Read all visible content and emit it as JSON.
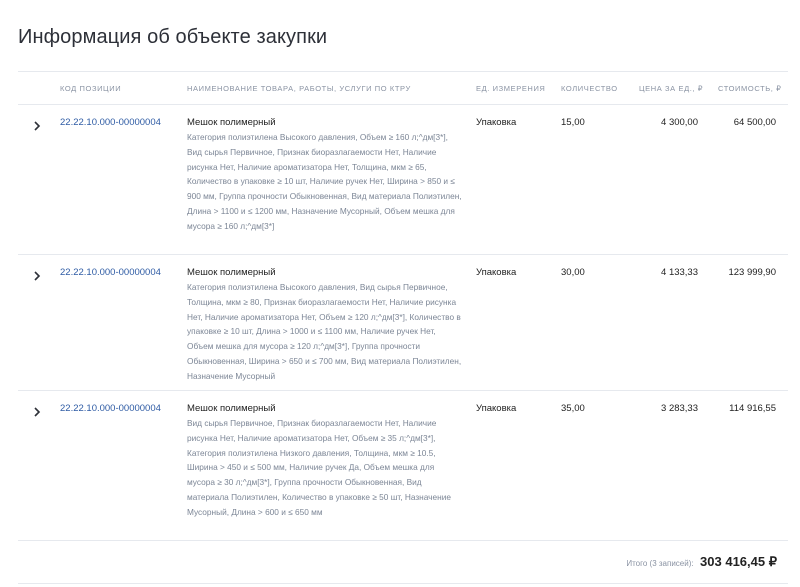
{
  "title": "Информация об объекте закупки",
  "columns": {
    "code": "КОД ПОЗИЦИИ",
    "name": "НАИМЕНОВАНИЕ ТОВАРА, РАБОТЫ, УСЛУГИ ПО КТРУ",
    "unit": "ЕД. ИЗМЕРЕНИЯ",
    "qty": "КОЛИЧЕСТВО",
    "price": "ЦЕНА ЗА ЕД., ₽",
    "total": "СТОИМОСТЬ, ₽"
  },
  "rows": [
    {
      "code": "22.22.10.000-00000004",
      "name": "Мешок полимерный",
      "desc": "Категория полиэтилена Высокого давления, Объем ≥ 160 л;^дм[3*], Вид сырья Первичное, Признак биоразлагаемости Нет, Наличие рисунка Нет, Наличие ароматизатора Нет, Толщина, мкм ≥ 65, Количество в упаковке ≥ 10 шт, Наличие ручек Нет, Ширина > 850 и ≤ 900 мм, Группа прочности Обыкновенная, Вид материала Полиэтилен, Длина > 1100 и ≤ 1200 мм, Назначение Мусорный, Объем мешка для мусора ≥ 160 л;^дм[3*]",
      "unit": "Упаковка",
      "qty": "15,00",
      "price": "4 300,00",
      "total": "64 500,00"
    },
    {
      "code": "22.22.10.000-00000004",
      "name": "Мешок полимерный",
      "desc": "Категория полиэтилена Высокого давления, Вид сырья Первичное, Толщина, мкм ≥ 80, Признак биоразлагаемости Нет, Наличие рисунка Нет, Наличие ароматизатора Нет, Объем ≥ 120 л;^дм[3*], Количество в упаковке ≥ 10 шт, Длина > 1000 и ≤ 1100 мм, Наличие ручек Нет, Объем мешка для мусора ≥ 120 л;^дм[3*], Группа прочности Обыкновенная, Ширина > 650 и ≤ 700 мм, Вид материала Полиэтилен, Назначение Мусорный",
      "unit": "Упаковка",
      "qty": "30,00",
      "price": "4 133,33",
      "total": "123 999,90"
    },
    {
      "code": "22.22.10.000-00000004",
      "name": "Мешок полимерный",
      "desc": "Вид сырья Первичное, Признак биоразлагаемости Нет, Наличие рисунка Нет, Наличие ароматизатора Нет, Объем ≥ 35 л;^дм[3*], Категория полиэтилена Низкого давления, Толщина, мкм ≥ 10.5, Ширина > 450 и ≤ 500 мм, Наличие ручек Да, Объем мешка для мусора ≥ 30 л;^дм[3*], Группа прочности Обыкновенная, Вид материала Полиэтилен, Количество в упаковке ≥ 50 шт, Назначение Мусорный, Длина > 600 и ≤ 650 мм",
      "unit": "Упаковка",
      "qty": "35,00",
      "price": "3 283,33",
      "total": "114 916,55"
    }
  ],
  "footer": {
    "label": "Итого (3 записей):",
    "sum": "303 416,45 ₽"
  }
}
